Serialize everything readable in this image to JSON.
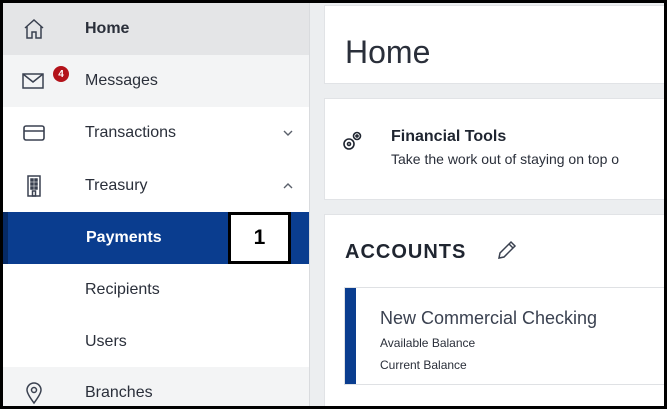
{
  "sidebar": {
    "items": [
      {
        "label": "Home",
        "icon": "home-icon"
      },
      {
        "label": "Messages",
        "icon": "mail-icon",
        "badge": "4"
      },
      {
        "label": "Transactions",
        "icon": "card-icon",
        "chevron": "down"
      },
      {
        "label": "Treasury",
        "icon": "building-icon",
        "chevron": "up"
      },
      {
        "label": "Payments",
        "selected": true
      },
      {
        "label": "Recipients"
      },
      {
        "label": "Users"
      },
      {
        "label": "Branches",
        "icon": "location-pin-icon"
      }
    ]
  },
  "callout": {
    "number": "1"
  },
  "main": {
    "home_title": "Home",
    "financial_tools": {
      "title": "Financial Tools",
      "description": "Take the work out of staying on top o",
      "icon": "tools-icon"
    },
    "accounts": {
      "title": "ACCOUNTS",
      "edit_icon": "pencil-icon",
      "items": [
        {
          "name": "New Commercial Checking",
          "line1": "Available Balance",
          "line2": "Current Balance"
        }
      ]
    }
  },
  "colors": {
    "selected_bg": "#0a3d8f",
    "badge": "#b3121a"
  }
}
